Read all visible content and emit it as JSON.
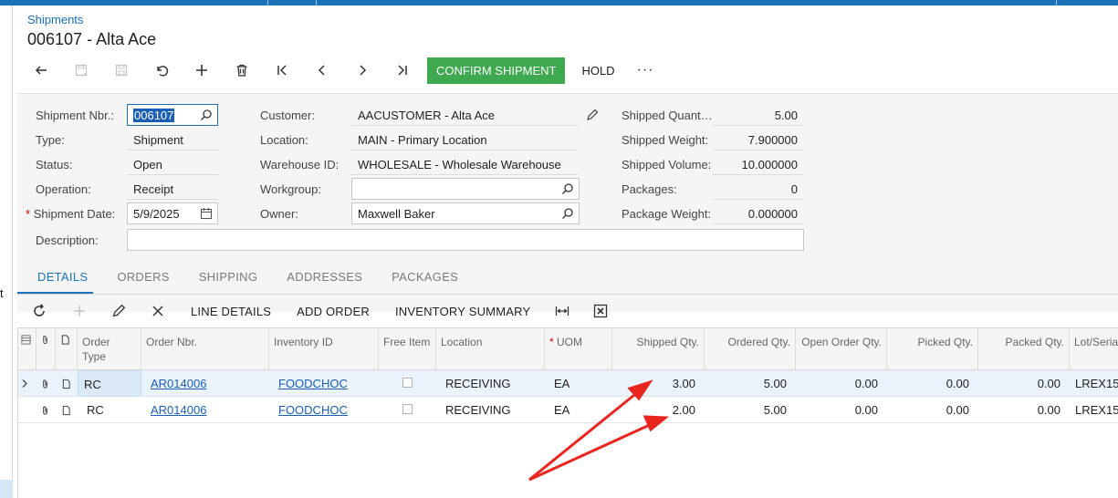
{
  "breadcrumb": "Shipments",
  "page_title": "006107 - Alta Ace",
  "toolbar": {
    "confirm_label": "CONFIRM SHIPMENT",
    "hold_label": "HOLD",
    "more_label": "···"
  },
  "rail_text": "t",
  "form": {
    "shipment_nbr": {
      "label": "Shipment Nbr.:",
      "value": "006107"
    },
    "type": {
      "label": "Type:",
      "value": "Shipment"
    },
    "status": {
      "label": "Status:",
      "value": "Open"
    },
    "operation": {
      "label": "Operation:",
      "value": "Receipt"
    },
    "shipment_date": {
      "required": "*",
      "label": "Shipment Date:",
      "value": "5/9/2025"
    },
    "description": {
      "label": "Description:",
      "value": ""
    },
    "customer": {
      "label": "Customer:",
      "value": "AACUSTOMER - Alta Ace"
    },
    "location": {
      "label": "Location:",
      "value": "MAIN - Primary Location"
    },
    "warehouse": {
      "label": "Warehouse ID:",
      "value": "WHOLESALE - Wholesale Warehouse"
    },
    "workgroup": {
      "label": "Workgroup:",
      "value": ""
    },
    "owner": {
      "label": "Owner:",
      "value": "Maxwell Baker"
    },
    "shipped_quantity": {
      "label": "Shipped Quant…",
      "value": "5.00"
    },
    "shipped_weight": {
      "label": "Shipped Weight:",
      "value": "7.900000"
    },
    "shipped_volume": {
      "label": "Shipped Volume:",
      "value": "10.000000"
    },
    "packages": {
      "label": "Packages:",
      "value": "0"
    },
    "package_weight": {
      "label": "Package Weight:",
      "value": "0.000000"
    }
  },
  "tabs": [
    "DETAILS",
    "ORDERS",
    "SHIPPING",
    "ADDRESSES",
    "PACKAGES"
  ],
  "grid_toolbar": {
    "line_details": "LINE DETAILS",
    "add_order": "ADD ORDER",
    "inventory_summary": "INVENTORY SUMMARY"
  },
  "grid": {
    "columns": {
      "order_type": "Order Type",
      "order_nbr": "Order Nbr.",
      "inventory_id": "Inventory ID",
      "free_item": "Free Item",
      "location": "Location",
      "uom_req": "*",
      "uom": "UOM",
      "shipped_qty": "Shipped Qty.",
      "ordered_qty": "Ordered Qty.",
      "open_order_qty": "Open Order Qty.",
      "picked_qty": "Picked Qty.",
      "packed_qty": "Packed Qty.",
      "lot_serial": "Lot/Seria"
    },
    "rows": [
      {
        "order_type": "RC",
        "order_nbr": "AR014006",
        "inventory_id": "FOODCHOC",
        "location": "RECEIVING",
        "uom": "EA",
        "shipped_qty": "3.00",
        "ordered_qty": "5.00",
        "open_order_qty": "0.00",
        "picked_qty": "0.00",
        "packed_qty": "0.00",
        "lot_serial": "LREX15"
      },
      {
        "order_type": "RC",
        "order_nbr": "AR014006",
        "inventory_id": "FOODCHOC",
        "location": "RECEIVING",
        "uom": "EA",
        "shipped_qty": "2.00",
        "ordered_qty": "5.00",
        "open_order_qty": "0.00",
        "picked_qty": "0.00",
        "packed_qty": "0.00",
        "lot_serial": "LREX15"
      }
    ]
  },
  "colors": {
    "accent": "#1a73b8",
    "confirm": "#3ea94f",
    "annotation": "#e8261f",
    "link": "#1a5fb4"
  }
}
